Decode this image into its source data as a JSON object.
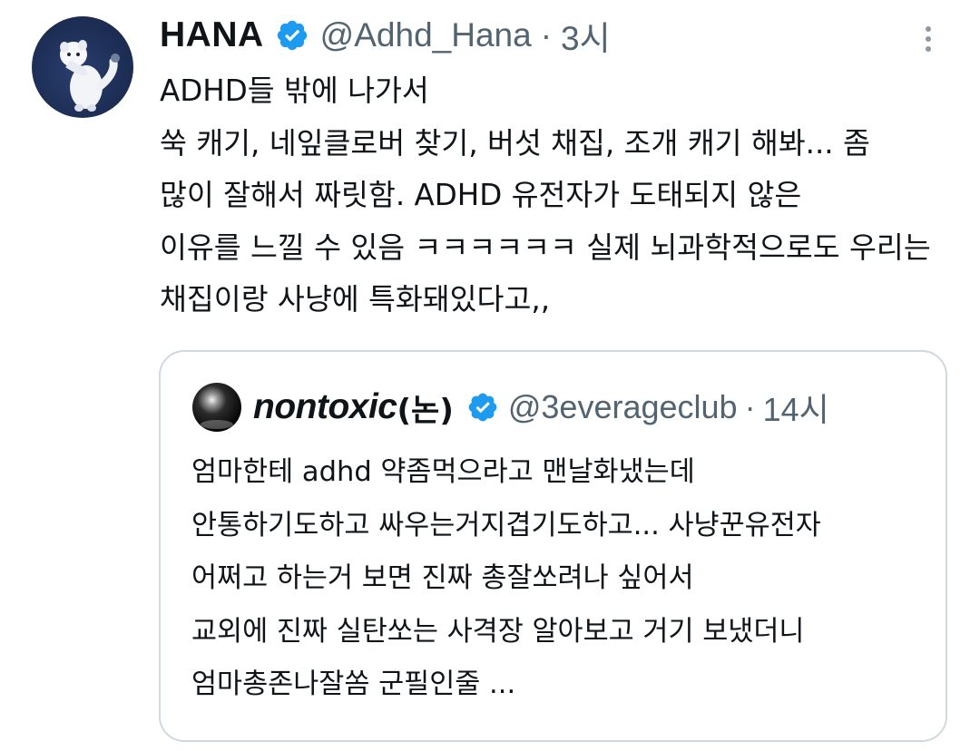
{
  "tweet": {
    "author": {
      "display_name": "HANA",
      "handle": "@Adhd_Hana",
      "separator": "·",
      "time": "3시",
      "verified_icon": "verified-badge-icon",
      "avatar_icon": "white-ferret-avatar"
    },
    "more_icon": "more-vertical-icon",
    "body_lines": [
      "ADHD들 밖에 나가서",
      "쑥 캐기, 네잎클로버 찾기, 버섯 채집, 조개 캐기 해봐... 좀",
      "많이 잘해서 짜릿함. ADHD 유전자가 도태되지 않은",
      "이유를 느낄 수 있음 ㅋㅋㅋㅋㅋㅋ 실제 뇌과학적으로도 우리는",
      "채집이랑 사냥에 특화돼있다고,,"
    ],
    "quoted": {
      "author": {
        "display_name": "nontoxic",
        "display_name_suffix": "(논)",
        "handle": "@3everageclub",
        "separator": "·",
        "time": "14시",
        "verified_icon": "verified-badge-icon",
        "avatar_icon": "black-sphere-avatar"
      },
      "body_lines": [
        "엄마한테 adhd 약좀먹으라고 맨날화냈는데",
        "안통하기도하고 싸우는거지겹기도하고... 사냥꾼유전자",
        "어쩌고 하는거 보면 진짜 총잘쏘려나 싶어서",
        "교외에 진짜 실탄쏘는 사격장 알아보고 거기 보냈더니",
        "엄마총존나잘쏨 군필인줄 ..."
      ]
    },
    "colors": {
      "text": "#0f1419",
      "secondary": "#536471",
      "verified": "#1d9bf0",
      "border": "#cfd9de"
    }
  }
}
